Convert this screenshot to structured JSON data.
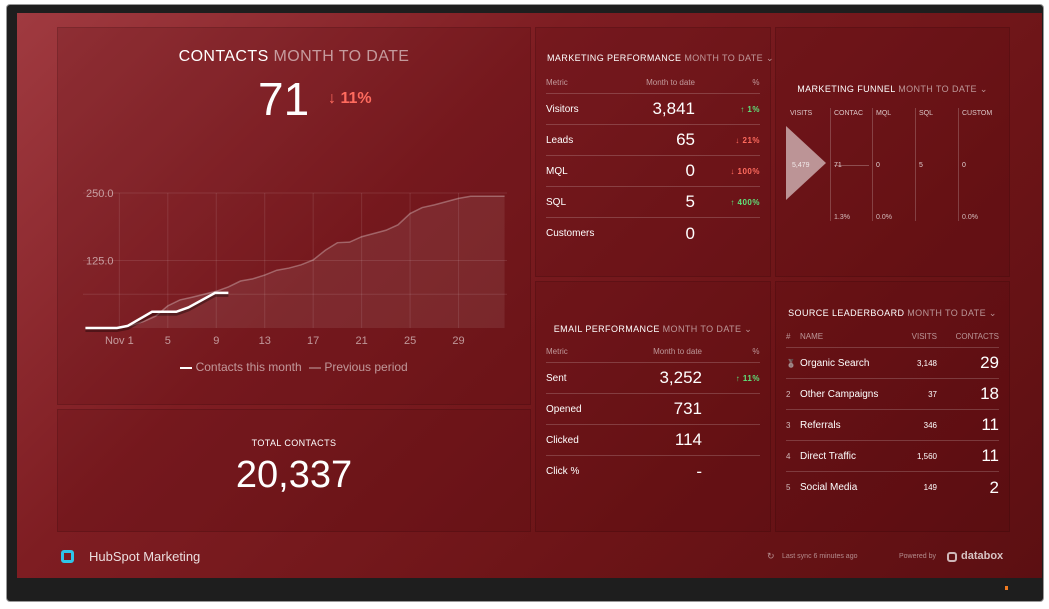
{
  "contacts": {
    "title": "CONTACTS",
    "period": "MONTH TO DATE",
    "value": "71",
    "change": "↓ 11%",
    "legend": {
      "current": "Contacts this month",
      "previous": "Previous period"
    }
  },
  "chart_data": {
    "type": "line",
    "xlabel": "",
    "ylabel": "",
    "x_ticks": [
      {
        "x": 1,
        "label": "Nov 1"
      },
      {
        "x": 5,
        "label": "5"
      },
      {
        "x": 9,
        "label": "9"
      },
      {
        "x": 13,
        "label": "13"
      },
      {
        "x": 17,
        "label": "17"
      },
      {
        "x": 21,
        "label": "21"
      },
      {
        "x": 25,
        "label": "25"
      },
      {
        "x": 29,
        "label": "29"
      }
    ],
    "y_ticks": [
      {
        "y": 125,
        "label": "125.0"
      },
      {
        "y": 250,
        "label": "250.0"
      }
    ],
    "xlim": [
      -2,
      33
    ],
    "ylim": [
      0,
      250
    ],
    "grid": true,
    "legend_position": "bottom",
    "series": [
      {
        "name": "Contacts this month",
        "color": "#ffffff",
        "points": [
          [
            -1.8,
            0
          ],
          [
            0.8,
            0
          ],
          [
            1.7,
            4
          ],
          [
            3.7,
            30
          ],
          [
            5.7,
            30
          ],
          [
            6.7,
            38
          ],
          [
            8.9,
            65
          ],
          [
            10,
            65
          ]
        ]
      },
      {
        "name": "Previous period",
        "color": "rgba(255,255,255,0.3)",
        "area": true,
        "points": [
          [
            -1.8,
            0
          ],
          [
            1,
            0
          ],
          [
            2,
            5
          ],
          [
            3,
            12
          ],
          [
            4,
            22
          ],
          [
            5,
            41
          ],
          [
            6,
            52
          ],
          [
            7,
            57
          ],
          [
            9,
            68
          ],
          [
            10,
            76
          ],
          [
            11,
            87
          ],
          [
            12,
            91
          ],
          [
            13,
            98
          ],
          [
            14,
            107
          ],
          [
            15,
            111
          ],
          [
            16,
            117
          ],
          [
            17,
            126
          ],
          [
            18,
            144
          ],
          [
            19,
            158
          ],
          [
            20,
            159
          ],
          [
            21,
            169
          ],
          [
            22,
            175
          ],
          [
            23,
            181
          ],
          [
            24,
            191
          ],
          [
            25,
            212
          ],
          [
            26,
            223
          ],
          [
            27,
            228
          ],
          [
            28,
            234
          ],
          [
            29,
            240
          ],
          [
            30,
            244
          ],
          [
            32.8,
            244
          ]
        ]
      }
    ]
  },
  "total": {
    "title": "TOTAL CONTACTS",
    "value": "20,337"
  },
  "marketing": {
    "title": "MARKETING PERFORMANCE",
    "period": "MONTH TO DATE",
    "headers": [
      "Metric",
      "Month to date",
      "%"
    ],
    "rows": [
      {
        "metric": "Visitors",
        "value": "3,841",
        "pct": "↑ 1%",
        "dir": "up"
      },
      {
        "metric": "Leads",
        "value": "65",
        "pct": "↓ 21%",
        "dir": "down"
      },
      {
        "metric": "MQL",
        "value": "0",
        "pct": "↓ 100%",
        "dir": "down"
      },
      {
        "metric": "SQL",
        "value": "5",
        "pct": "↑ 400%",
        "dir": "up"
      },
      {
        "metric": "Customers",
        "value": "0",
        "pct": "",
        "dir": ""
      }
    ]
  },
  "funnel": {
    "title": "MARKETING FUNNEL",
    "period": "MONTH TO DATE",
    "stages": [
      {
        "label": "VISITS",
        "value": "5,479",
        "rate": ""
      },
      {
        "label": "CONTAC",
        "value": "71",
        "rate": "1.3%"
      },
      {
        "label": "MQL",
        "value": "0",
        "rate": "0.0%"
      },
      {
        "label": "SQL",
        "value": "5",
        "rate": ""
      },
      {
        "label": "CUSTOM",
        "value": "0",
        "rate": "0.0%"
      }
    ]
  },
  "email": {
    "title": "EMAIL PERFORMANCE",
    "period": "MONTH TO DATE",
    "headers": [
      "Metric",
      "Month to date",
      "%"
    ],
    "rows": [
      {
        "metric": "Sent",
        "value": "3,252",
        "pct": "↑ 11%",
        "dir": "up"
      },
      {
        "metric": "Opened",
        "value": "731",
        "pct": "",
        "dir": ""
      },
      {
        "metric": "Clicked",
        "value": "114",
        "pct": "",
        "dir": ""
      },
      {
        "metric": "Click %",
        "value": "-",
        "pct": "",
        "dir": ""
      }
    ]
  },
  "source": {
    "title": "SOURCE LEADERBOARD",
    "period": "MONTH TO DATE",
    "headers": [
      "#",
      "NAME",
      "VISITS",
      "CONTACTS"
    ],
    "rows": [
      {
        "rank": "",
        "icon": "medal-icon",
        "name": "Organic Search",
        "visits": "3,148",
        "contacts": "29"
      },
      {
        "rank": "2",
        "name": "Other Campaigns",
        "visits": "37",
        "contacts": "18"
      },
      {
        "rank": "3",
        "name": "Referrals",
        "visits": "346",
        "contacts": "11"
      },
      {
        "rank": "4",
        "name": "Direct Traffic",
        "visits": "1,560",
        "contacts": "11"
      },
      {
        "rank": "5",
        "name": "Social Media",
        "visits": "149",
        "contacts": "2"
      }
    ]
  },
  "footer": {
    "dashboard_name": "HubSpot Marketing",
    "sync": "Last sync 6 minutes ago",
    "powered_by": "Powered by",
    "brand": "databox",
    "logo_color": "#2fc5e8"
  }
}
